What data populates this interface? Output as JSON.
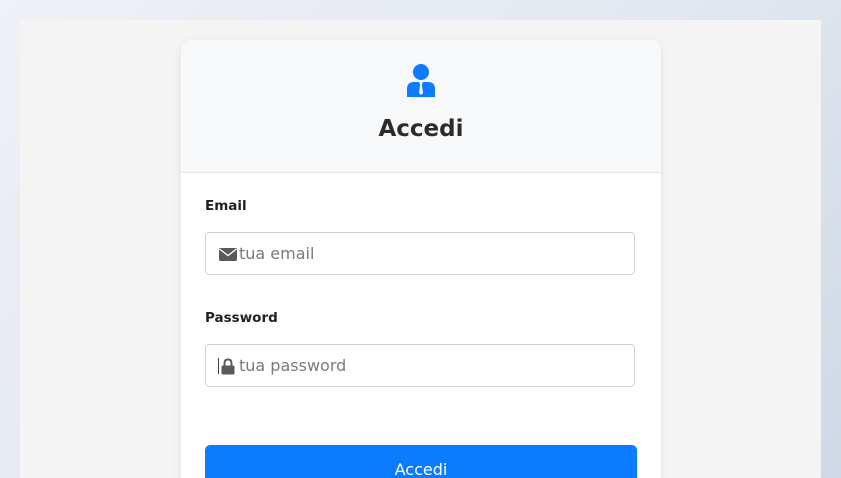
{
  "login": {
    "title": "Accedi",
    "icon": "user-tie-icon",
    "accent_color": "#0b7cff",
    "email": {
      "label": "Email",
      "placeholder": "tua email",
      "value": "",
      "icon": "envelope-icon"
    },
    "password": {
      "label": "Password",
      "placeholder": "tua password",
      "value": "",
      "icon": "lock-icon"
    },
    "submit_label": "Accedi"
  }
}
